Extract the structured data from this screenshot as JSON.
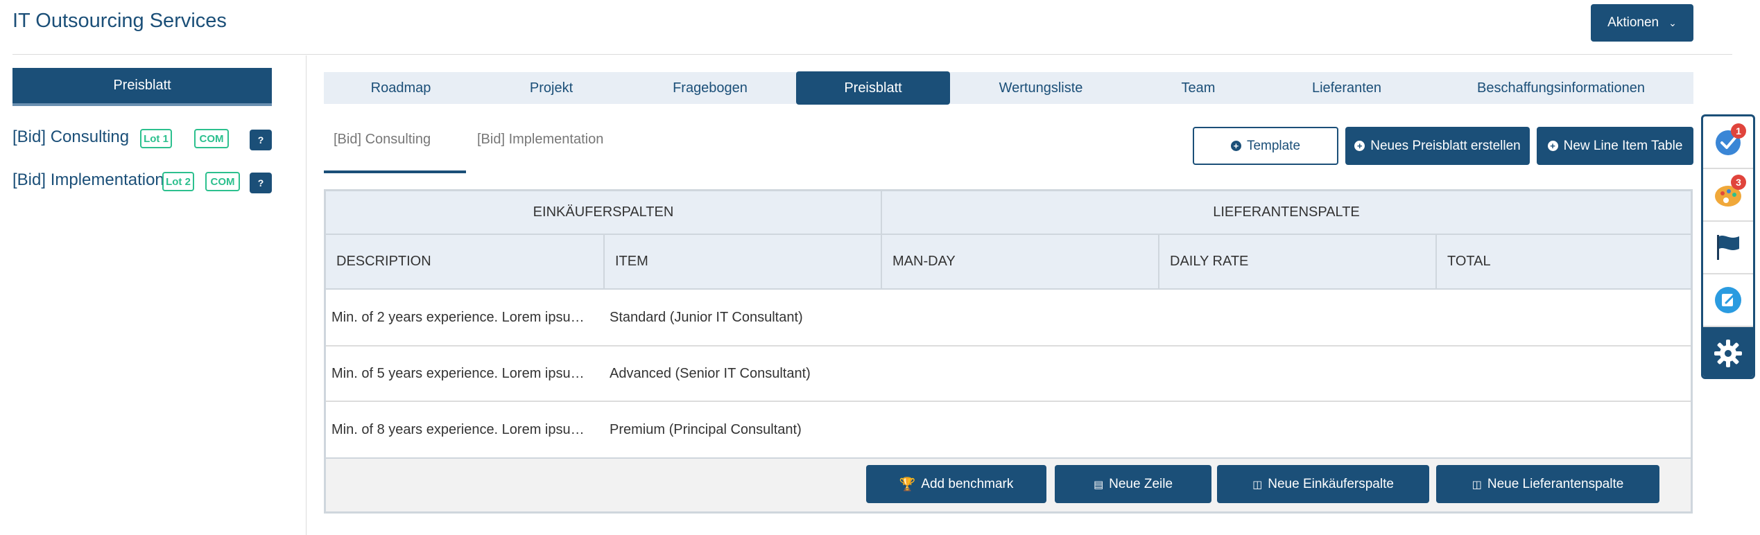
{
  "header": {
    "title": "IT Outsourcing Services",
    "actions_label": "Aktionen",
    "actions_icon": "chevron-down-icon"
  },
  "sidebar": {
    "active_button": "Preisblatt",
    "items": [
      {
        "label": "[Bid] Consulting",
        "lot": "Lot 1",
        "tag": "COM",
        "help": "?"
      },
      {
        "label": "[Bid] Implementation",
        "lot": "Lot 2",
        "tag": "COM",
        "help": "?"
      }
    ]
  },
  "tabs": [
    {
      "label": "Roadmap",
      "active": false
    },
    {
      "label": "Projekt",
      "active": false
    },
    {
      "label": "Fragebogen",
      "active": false
    },
    {
      "label": "Preisblatt",
      "active": true
    },
    {
      "label": "Wertungsliste",
      "active": false
    },
    {
      "label": "Team",
      "active": false
    },
    {
      "label": "Lieferanten",
      "active": false
    },
    {
      "label": "Beschaffungsinformationen",
      "active": false
    }
  ],
  "subtabs": [
    {
      "label": "[Bid] Consulting",
      "active": true
    },
    {
      "label": "[Bid] Implementation",
      "active": false
    }
  ],
  "action_buttons": {
    "template": "Template",
    "new_sheet": "Neues Preisblatt erstellen",
    "new_line_item": "New Line Item Table"
  },
  "table": {
    "group_headers": [
      "EINKÄUFERSPALTEN",
      "LIEFERANTENSPALTE"
    ],
    "columns": [
      "DESCRIPTION",
      "ITEM",
      "MAN-DAY",
      "DAILY RATE",
      "TOTAL"
    ],
    "rows": [
      {
        "description": "Min. of 2 years experience. Lorem ipsu…",
        "item": "Standard (Junior IT Consultant)",
        "man_day": "",
        "daily_rate": "",
        "total": ""
      },
      {
        "description": "Min. of 5 years experience. Lorem ipsu…",
        "item": "Advanced (Senior IT Consultant)",
        "man_day": "",
        "daily_rate": "",
        "total": ""
      },
      {
        "description": "Min. of 8 years experience. Lorem ipsu…",
        "item": "Premium (Principal Consultant)",
        "man_day": "",
        "daily_rate": "",
        "total": ""
      }
    ],
    "footer_buttons": {
      "benchmark": "Add benchmark",
      "new_row": "Neue Zeile",
      "new_buyer_col": "Neue Einkäuferspalte",
      "new_supplier_col": "Neue Lieferantenspalte"
    }
  },
  "float_panel": {
    "tasks_badge": "1",
    "palette_badge": "3",
    "icons": [
      "check-circle-icon",
      "palette-icon",
      "flag-icon",
      "note-edit-icon",
      "gear-icon"
    ]
  },
  "colors": {
    "primary": "#1b4f78",
    "tab_bg": "#e8eef5",
    "tag_green": "#2cc08e",
    "badge_red": "#e0443c"
  }
}
